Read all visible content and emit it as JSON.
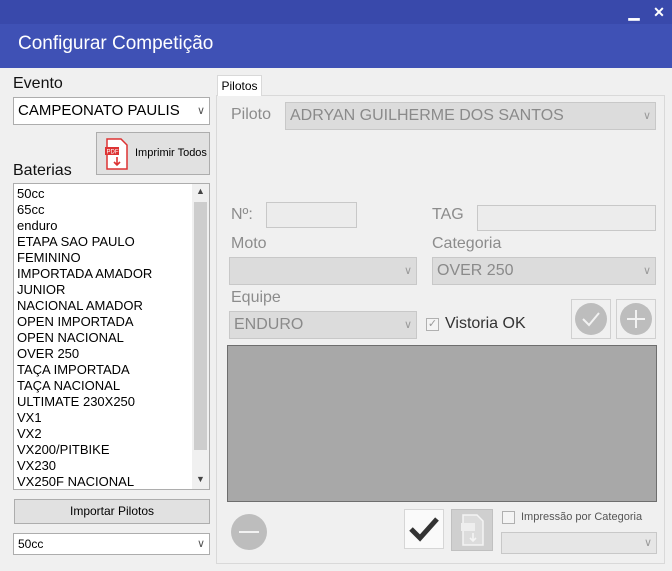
{
  "window": {
    "title": "Configurar Competição",
    "minimize_glyph": "▁",
    "close_glyph": "✕"
  },
  "left": {
    "evento_label": "Evento",
    "evento_value": "CAMPEONATO PAULIS",
    "imprimir_todos_label": "Imprimir Todos",
    "baterias_label": "Baterias",
    "baterias": [
      "50cc",
      "65cc",
      "enduro",
      "ETAPA SAO PAULO",
      "FEMININO",
      "IMPORTADA AMADOR",
      "JUNIOR",
      "NACIONAL AMADOR",
      "OPEN IMPORTADA",
      "OPEN NACIONAL",
      "OVER 250",
      "TAÇA IMPORTADA",
      "TAÇA NACIONAL",
      "ULTIMATE 230X250",
      "VX1",
      "VX2",
      "VX200/PITBIKE",
      "VX230",
      "VX250F NACIONAL"
    ],
    "importar_label": "Importar Pilotos",
    "bottom_select_value": "50cc"
  },
  "tab": {
    "label": "Pilotos"
  },
  "form": {
    "piloto_label": "Piloto",
    "piloto_value": "ADRYAN GUILHERME DOS SANTOS",
    "numero_label": "Nº:",
    "tag_label": "TAG",
    "moto_label": "Moto",
    "moto_value": "",
    "categoria_label": "Categoria",
    "categoria_value": "OVER 250",
    "equipe_label": "Equipe",
    "equipe_value": "ENDURO",
    "vistoria_label": "Vistoria OK",
    "impressao_label": "Impressão por Categoria"
  },
  "icons": {
    "confirm": "check-circle-icon",
    "add": "plus-circle-icon",
    "remove": "minus-circle-icon",
    "save": "checkmark-icon",
    "print": "pdf-print-icon"
  },
  "colors": {
    "header": "#3f51b5",
    "header_strip": "#3949ab"
  }
}
